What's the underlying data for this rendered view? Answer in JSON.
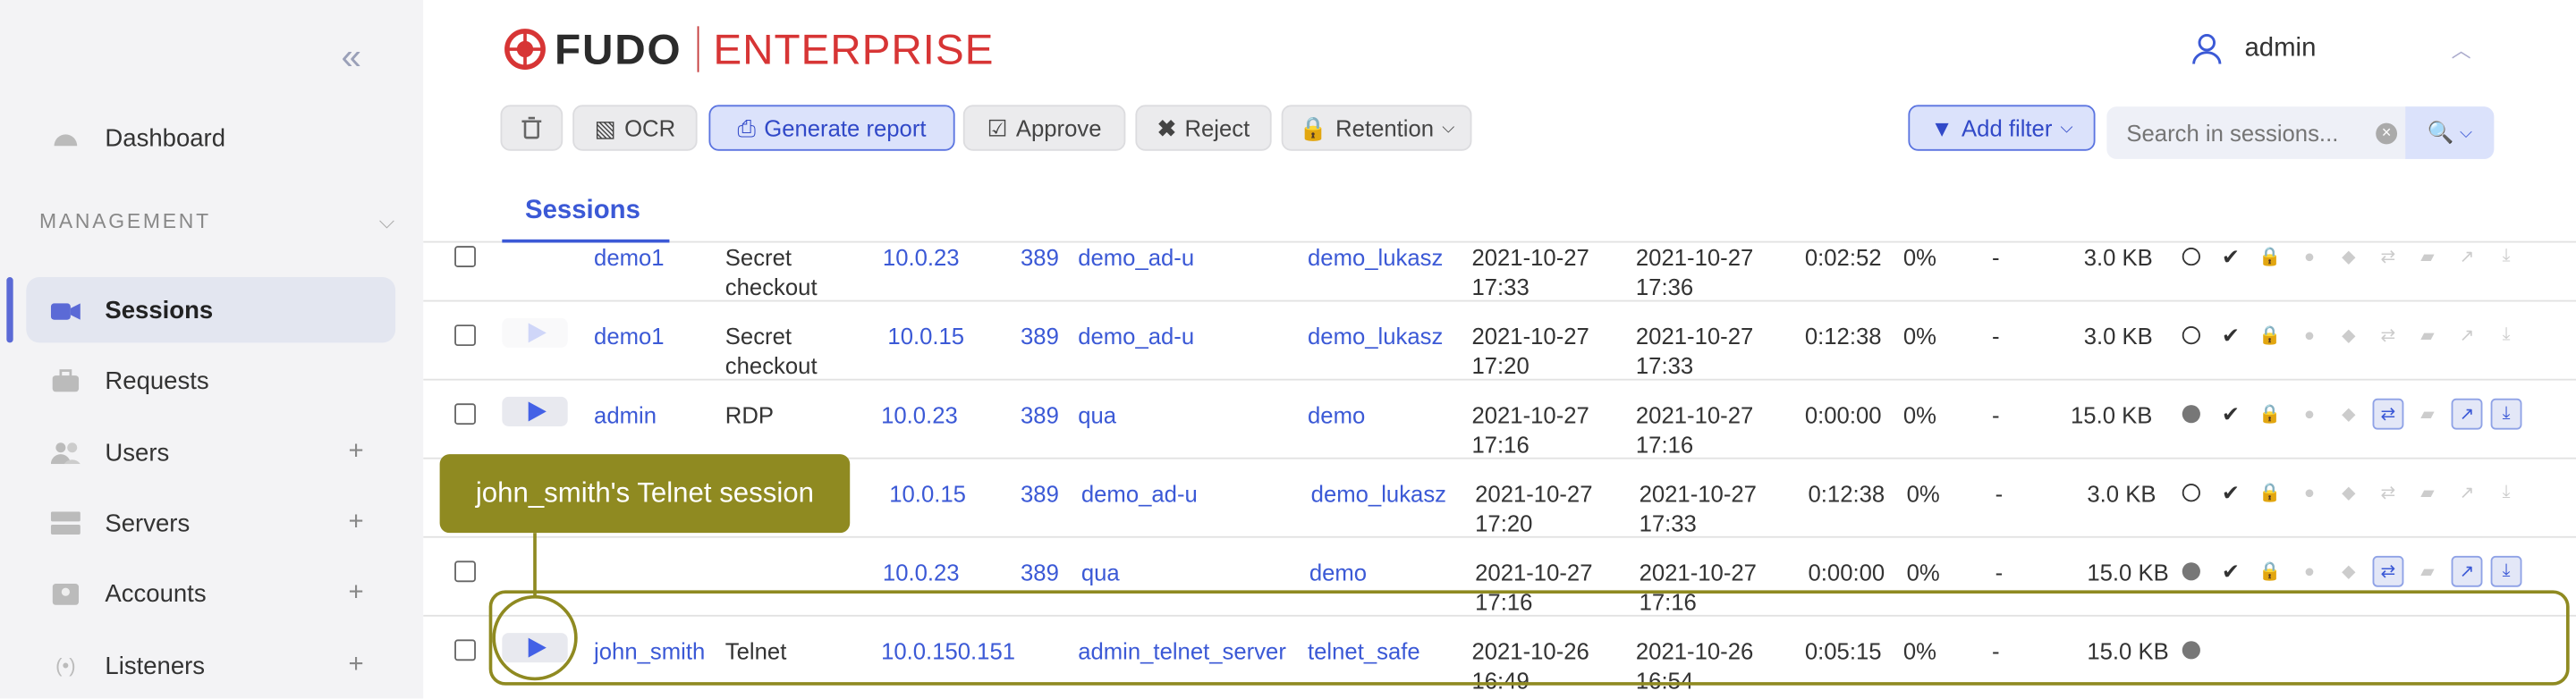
{
  "sidebar": {
    "items": [
      {
        "label": "Dashboard"
      },
      {
        "label": "Sessions"
      },
      {
        "label": "Requests"
      },
      {
        "label": "Users",
        "plus": "+"
      },
      {
        "label": "Servers",
        "plus": "+"
      },
      {
        "label": "Accounts",
        "plus": "+"
      },
      {
        "label": "Listeners",
        "plus": "+"
      }
    ],
    "section": "MANAGEMENT"
  },
  "header": {
    "brand": "FUDO",
    "edition": "ENTERPRISE",
    "user": "admin"
  },
  "toolbar": {
    "ocr": "OCR",
    "generate": "Generate report",
    "approve": "Approve",
    "reject": "Reject",
    "retention": "Retention",
    "add_filter": "Add filter",
    "search_placeholder": "Search in sessions..."
  },
  "tabs": {
    "sessions": "Sessions"
  },
  "tooltip": "john_smith's Telnet session",
  "rows": [
    {
      "user": "demo1",
      "protocol": "Secret",
      "protocol2": "checkout",
      "ip": "10.0.23",
      "port": "389",
      "server": "demo_ad-u",
      "account": "demo_lukasz",
      "start": "2021-10-27",
      "start_t": "17:33",
      "end": "2021-10-27",
      "end_t": "17:36",
      "dur": "0:02:52",
      "pct": "0%",
      "dash": "-",
      "size": "3.0 KB"
    },
    {
      "user": "demo1",
      "protocol": "Secret",
      "protocol2": "checkout",
      "ip": "10.0.15",
      "port": "389",
      "server": "demo_ad-u",
      "account": "demo_lukasz",
      "start": "2021-10-27",
      "start_t": "17:20",
      "end": "2021-10-27",
      "end_t": "17:33",
      "dur": "0:12:38",
      "pct": "0%",
      "dash": "-",
      "size": "3.0 KB"
    },
    {
      "user": "admin",
      "protocol": "RDP",
      "protocol2": "",
      "ip": "10.0.23",
      "port": "389",
      "server": "qua",
      "account": "demo",
      "start": "2021-10-27",
      "start_t": "17:16",
      "end": "2021-10-27",
      "end_t": "17:16",
      "dur": "0:00:00",
      "pct": "0%",
      "dash": "-",
      "size": "15.0 KB"
    },
    {
      "user": "",
      "protocol": "",
      "protocol2": "",
      "ip": "10.0.15",
      "port": "389",
      "server": "demo_ad-u",
      "account": "demo_lukasz",
      "start": "2021-10-27",
      "start_t": "17:20",
      "end": "2021-10-27",
      "end_t": "17:33",
      "dur": "0:12:38",
      "pct": "0%",
      "dash": "-",
      "size": "3.0 KB"
    },
    {
      "user": "",
      "protocol": "",
      "protocol2": "",
      "ip": "10.0.23",
      "port": "389",
      "server": "qua",
      "account": "demo",
      "start": "2021-10-27",
      "start_t": "17:16",
      "end": "2021-10-27",
      "end_t": "17:16",
      "dur": "0:00:00",
      "pct": "0%",
      "dash": "-",
      "size": "15.0 KB"
    },
    {
      "user": "john_smith",
      "protocol": "Telnet",
      "protocol2": "",
      "ip": "10.0.150.151",
      "port": "",
      "server": "admin_telnet_server",
      "account": "telnet_safe",
      "start": "2021-10-26",
      "start_t": "16:49",
      "end": "2021-10-26",
      "end_t": "16:54",
      "dur": "0:05:15",
      "pct": "0%",
      "dash": "-",
      "size": "15.0 KB"
    }
  ],
  "colors": {
    "accent": "#3b59d6",
    "highlight": "#8f8a21",
    "brand_red": "#d73535"
  }
}
